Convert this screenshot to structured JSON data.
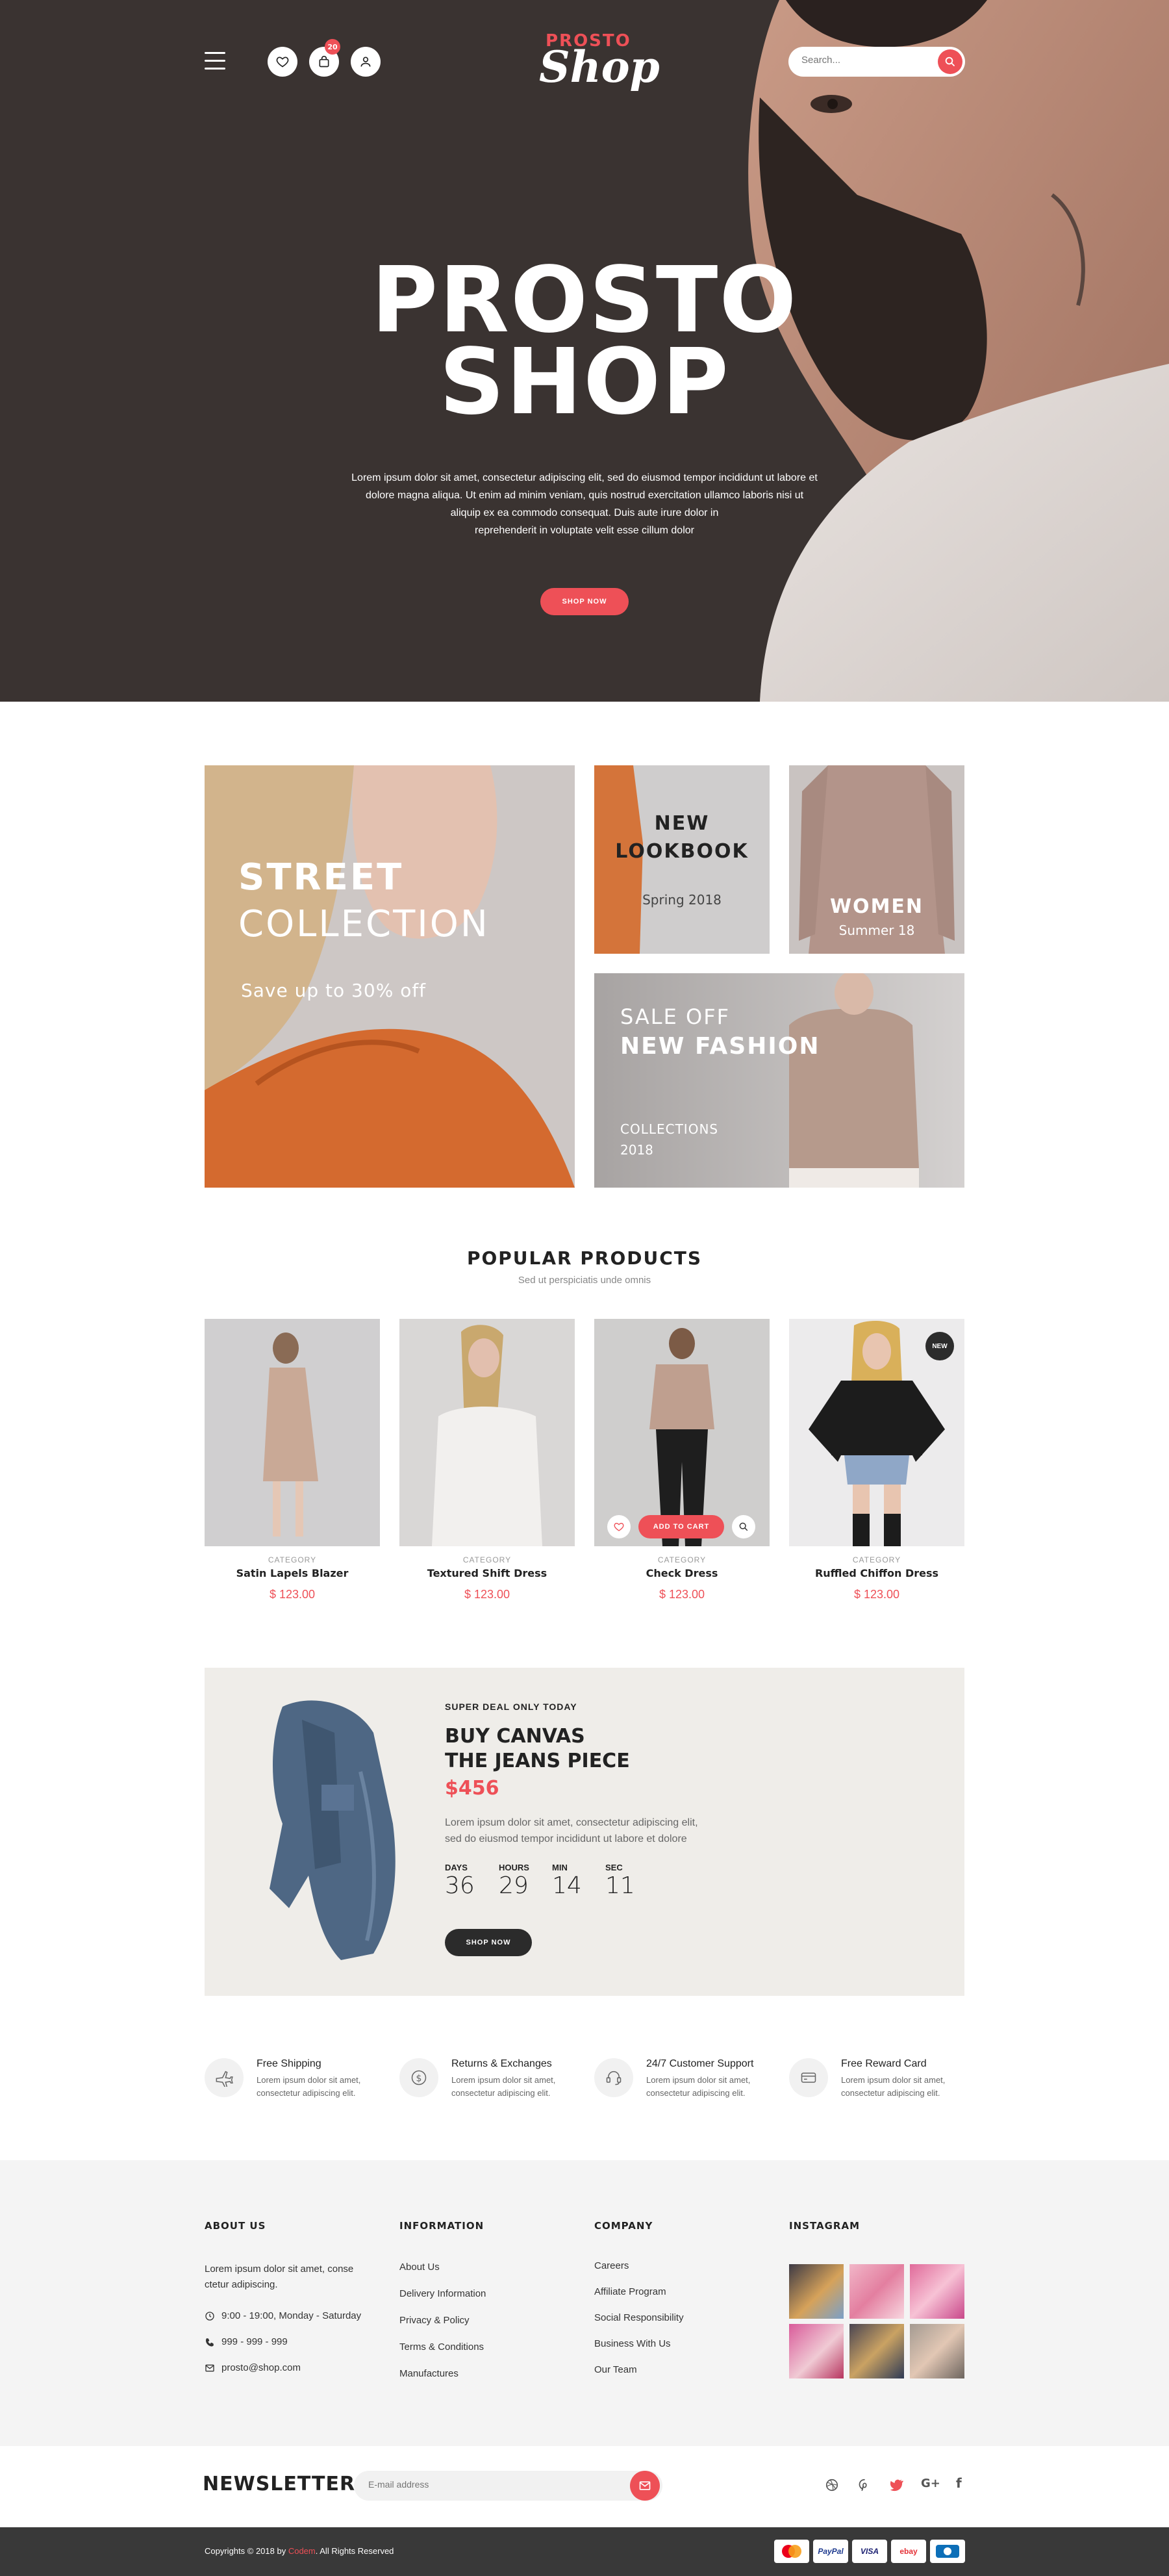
{
  "header": {
    "cart_count": "20",
    "logo_top": "PROSTO",
    "logo_bottom": "Shop",
    "search_placeholder": "Search..."
  },
  "hero": {
    "title_line1": "PROSTO",
    "title_line2": "SHOP",
    "desc_line1": "Lorem ipsum dolor sit amet, consectetur adipiscing elit, sed do eiusmod tempor incididunt ut labore et",
    "desc_line2": "dolore magna aliqua. Ut enim ad minim veniam, quis nostrud exercitation ullamco laboris nisi ut",
    "desc_line3": "aliquip ex ea commodo consequat. Duis aute irure dolor in",
    "desc_line4": "reprehenderit in voluptate velit esse cillum dolor",
    "cta": "SHOP NOW"
  },
  "banners": {
    "street": {
      "line1": "STREET",
      "line2": "COLLECTION",
      "sub": "Save up to 30% off"
    },
    "lookbook": {
      "line1": "NEW",
      "line2": "LOOKBOOK",
      "sub": "Spring 2018"
    },
    "women": {
      "title": "WOMEN",
      "sub": "Summer 18"
    },
    "sale": {
      "line1": "SALE OFF",
      "line2": "NEW FASHION",
      "sub1": "COLLECTIONS",
      "sub2": "2018"
    }
  },
  "popular": {
    "title": "POPULAR PRODUCTS",
    "subtitle": "Sed ut perspiciatis unde omnis",
    "add_to_cart": "ADD TO CART",
    "new_badge": "NEW",
    "products": [
      {
        "category": "CATEGORY",
        "name": "Satin Lapels Blazer",
        "price": "$ 123.00"
      },
      {
        "category": "CATEGORY",
        "name": "Textured Shift Dress",
        "price": "$ 123.00"
      },
      {
        "category": "CATEGORY",
        "name": "Check Dress",
        "price": "$ 123.00"
      },
      {
        "category": "CATEGORY",
        "name": "Ruffled Chiffon Dress",
        "price": "$ 123.00"
      }
    ]
  },
  "deal": {
    "kicker": "SUPER DEAL ONLY TODAY",
    "title_line1": "BUY CANVAS",
    "title_line2": "THE JEANS PIECE",
    "price": "$456",
    "desc_line1": "Lorem ipsum dolor sit amet, consectetur adipiscing elit,",
    "desc_line2": "sed do eiusmod tempor incididunt ut labore et dolore",
    "countdown": [
      {
        "label": "DAYS",
        "value": "36"
      },
      {
        "label": "HOURS",
        "value": "29"
      },
      {
        "label": "MIN",
        "value": "14"
      },
      {
        "label": "SEC",
        "value": "11"
      }
    ],
    "cta": "SHOP NOW"
  },
  "features": [
    {
      "icon": "plane-icon",
      "title": "Free Shipping",
      "desc1": "Lorem ipsum dolor sit amet,",
      "desc2": "consectetur adipiscing elit."
    },
    {
      "icon": "dollar-icon",
      "title": "Returns & Exchanges",
      "desc1": "Lorem ipsum dolor sit amet,",
      "desc2": "consectetur adipiscing elit."
    },
    {
      "icon": "support-icon",
      "title": "24/7 Customer Support",
      "desc1": "Lorem ipsum dolor sit amet,",
      "desc2": "consectetur adipiscing elit."
    },
    {
      "icon": "card-icon",
      "title": "Free Reward Card",
      "desc1": "Lorem ipsum dolor sit amet,",
      "desc2": "consectetur adipiscing elit."
    }
  ],
  "footer": {
    "about": {
      "heading": "ABOUT US",
      "text1": "Lorem ipsum dolor sit amet, conse",
      "text2": "ctetur adipiscing.",
      "hours": "9:00 - 19:00, Monday - Saturday",
      "phone": "999 - 999 - 999",
      "email": "prosto@shop.com"
    },
    "information": {
      "heading": "INFORMATION",
      "links": [
        "About Us",
        "Delivery Information",
        "Privacy & Policy",
        "Terms & Conditions",
        "Manufactures"
      ]
    },
    "company": {
      "heading": "COMPANY",
      "links": [
        "Careers",
        "Affiliate Program",
        "Social Responsibility",
        "Business With Us",
        "Our Team"
      ]
    },
    "instagram": {
      "heading": "INSTAGRAM"
    }
  },
  "newsletter": {
    "title": "NEWSLETTER",
    "placeholder": "E-mail address",
    "social": [
      "dribbble-icon",
      "pinterest-icon",
      "twitter-icon",
      "google-plus-icon",
      "facebook-icon"
    ]
  },
  "bottom": {
    "copyright_prefix": "Copyrights © 2018 by ",
    "copyright_brand": "Codem",
    "copyright_suffix": ". All Rights Reserved",
    "payments": [
      "MasterCard",
      "PayPal",
      "VISA",
      "ebay",
      "Discover"
    ]
  },
  "colors": {
    "accent": "#ee5057",
    "hero_bg": "#3a3331",
    "deal_bg": "#efede9",
    "footer_bg": "#f4f4f4",
    "bottombar_bg": "#393939"
  }
}
